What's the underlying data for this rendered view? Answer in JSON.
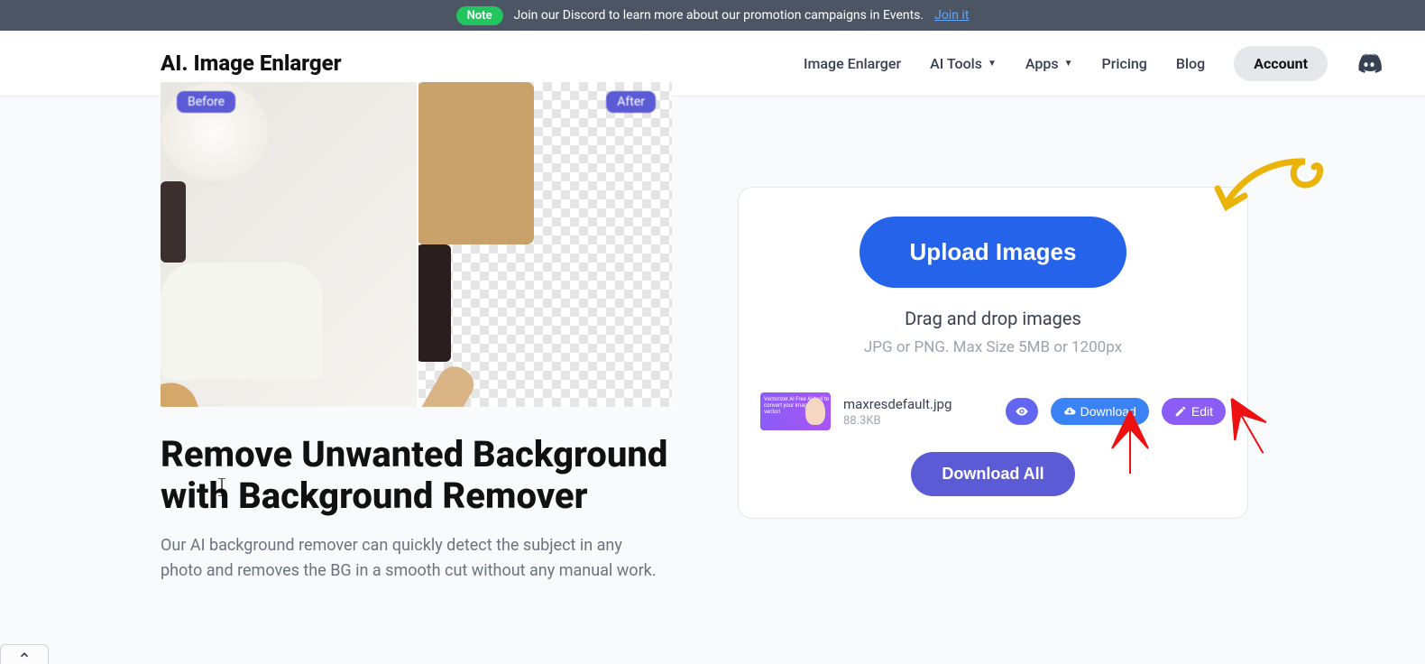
{
  "banner": {
    "note_label": "Note",
    "text": "Join our Discord to learn more about our promotion campaigns in Events.",
    "link_text": "Join it"
  },
  "header": {
    "logo": "AI. Image Enlarger",
    "nav": {
      "image_enlarger": "Image Enlarger",
      "ai_tools": "AI Tools",
      "apps": "Apps",
      "pricing": "Pricing",
      "blog": "Blog",
      "account": "Account"
    }
  },
  "compare": {
    "before_label": "Before",
    "after_label": "After"
  },
  "content": {
    "heading": "Remove Unwanted Background with Background Remover",
    "description": "Our AI background remover can quickly detect the subject in any photo and removes the BG in a smooth cut without any manual work."
  },
  "upload": {
    "button": "Upload Images",
    "drag_text": "Drag and drop images",
    "hint": "JPG or PNG. Max Size 5MB or 1200px",
    "file": {
      "name": "maxresdefault.jpg",
      "size": "88.3KB",
      "thumb_text": "Vectorizer.AI Free AI tool to convert your images to vector!"
    },
    "download_label": "Download",
    "edit_label": "Edit",
    "download_all": "Download All"
  }
}
